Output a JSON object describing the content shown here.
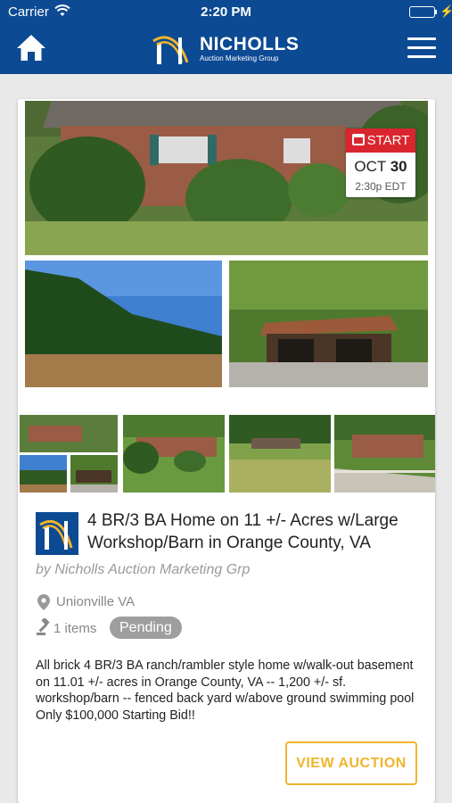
{
  "status_bar": {
    "carrier": "Carrier",
    "time": "2:20 PM",
    "icons": [
      "wifi-icon",
      "battery-icon",
      "charging-bolt-icon"
    ],
    "battery_color": "#4cd964"
  },
  "nav": {
    "background": "#0c4a93",
    "home_icon": "home-icon",
    "menu_icon": "hamburger-menu-icon",
    "logo": {
      "name": "NICHOLLS",
      "subtitle": "Auction Marketing Group"
    }
  },
  "auction": {
    "start": {
      "label": "START",
      "date_month": "OCT",
      "date_day": "30",
      "time": "2:30p EDT",
      "color": "#d9262e"
    },
    "photos": [
      "house-front-photo",
      "field-photo",
      "barn-photo",
      "house-side-photo",
      "property-collage-photo",
      "house-yard-photo",
      "house-deck-photo",
      "house-lawn-photo"
    ],
    "title": "4 BR/3 BA Home on 11 +/- Acres w/Large Workshop/Barn in Orange County, VA",
    "byline": "by Nicholls Auction Marketing Grp",
    "location": "Unionville VA",
    "items": "1 items",
    "status": "Pending",
    "description": "All brick 4 BR/3 BA ranch/rambler style home w/walk-out basement on 11.01 +/- acres in Orange County, VA -- 1,200 +/- sf. workshop/barn -- fenced back yard w/above ground swimming pool Only $100,000 Starting Bid!!",
    "button_label": "VIEW AUCTION",
    "accent_color": "#f0b52c"
  }
}
